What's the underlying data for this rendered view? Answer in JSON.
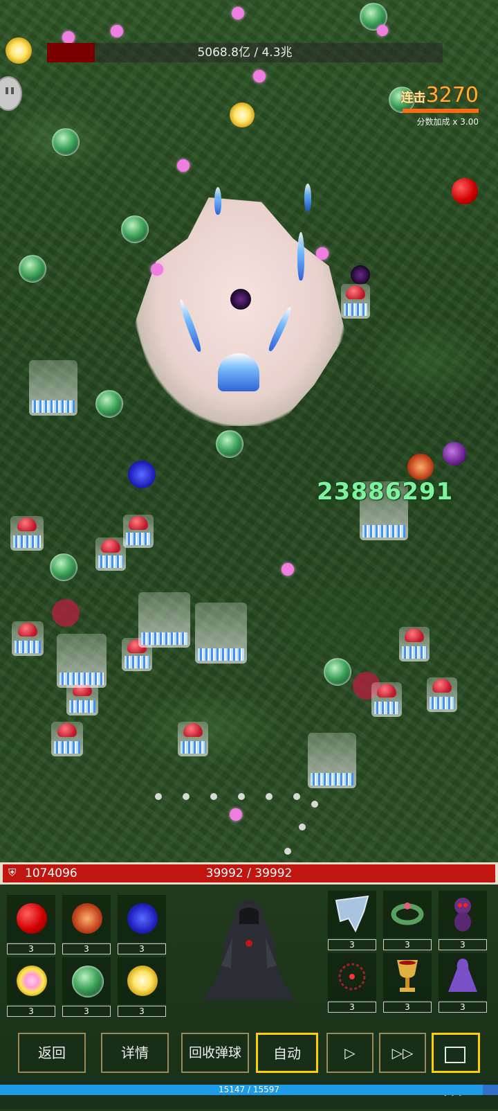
{
  "boss": {
    "hp_text": "5068.8亿 / 4.3兆",
    "hp_fraction": 0.12
  },
  "combo": {
    "label": "连击",
    "value": "3270",
    "multiplier": "分数加成 x 3.00"
  },
  "damage_popup": "23886291",
  "player": {
    "gold": "1074096",
    "hp_text": "39992 / 39992",
    "hp_fraction": 1.0
  },
  "ball_slots": [
    {
      "type": "red",
      "count": "3"
    },
    {
      "type": "orange",
      "count": "3"
    },
    {
      "type": "blue",
      "count": "3"
    },
    {
      "type": "yellow-pink",
      "count": "3"
    },
    {
      "type": "green",
      "count": "3"
    },
    {
      "type": "yellow-star",
      "count": "3"
    }
  ],
  "item_slots": [
    {
      "name": "cape-icon",
      "count": "3"
    },
    {
      "name": "wreath-icon",
      "count": "3"
    },
    {
      "name": "voodoo-doll-icon",
      "count": "3"
    },
    {
      "name": "thorn-ring-icon",
      "count": "3"
    },
    {
      "name": "chalice-icon",
      "count": "3"
    },
    {
      "name": "purple-cloak-icon",
      "count": "3"
    }
  ],
  "buttons": {
    "back": "返回",
    "details": "详情",
    "recall": "回收弹球",
    "auto": "自动",
    "play": "▷",
    "fast": "▷▷"
  },
  "xp": {
    "text": "15147 / 15597",
    "fraction": 0.97
  },
  "colors": {
    "boss_hp": "#7a0000",
    "player_hp": "#c0160f",
    "auto_border": "#ffd000",
    "combo": "#ffb030",
    "damage": "#7ff2a0"
  }
}
